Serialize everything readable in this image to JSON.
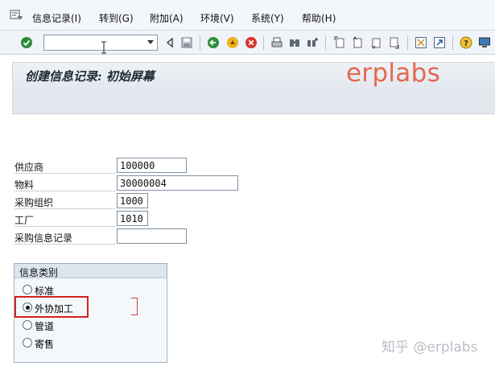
{
  "menu": {
    "items": [
      {
        "label": "信息记录(I)"
      },
      {
        "label": "转到(G)"
      },
      {
        "label": "附加(A)"
      },
      {
        "label": "环境(V)"
      },
      {
        "label": "系统(Y)"
      },
      {
        "label": "帮助(H)"
      }
    ]
  },
  "toolbar": {
    "command_value": ""
  },
  "page": {
    "title": "创建信息记录: 初始屏幕",
    "brand_watermark": "erplabs"
  },
  "form": {
    "fields": [
      {
        "label": "供应商",
        "value": "100000"
      },
      {
        "label": "物料",
        "value": "30000004"
      },
      {
        "label": "采购组织",
        "value": "1000"
      },
      {
        "label": "工厂",
        "value": "1010"
      },
      {
        "label": "采购信息记录",
        "value": ""
      }
    ]
  },
  "info_category": {
    "title": "信息类别",
    "options": [
      {
        "label": "标准",
        "selected": false
      },
      {
        "label": "外协加工",
        "selected": true
      },
      {
        "label": "管道",
        "selected": false
      },
      {
        "label": "寄售",
        "selected": false
      }
    ]
  },
  "credit_watermark": "知乎 @erplabs",
  "colors": {
    "highlight": "#d32020",
    "brand": "#e5674d"
  }
}
